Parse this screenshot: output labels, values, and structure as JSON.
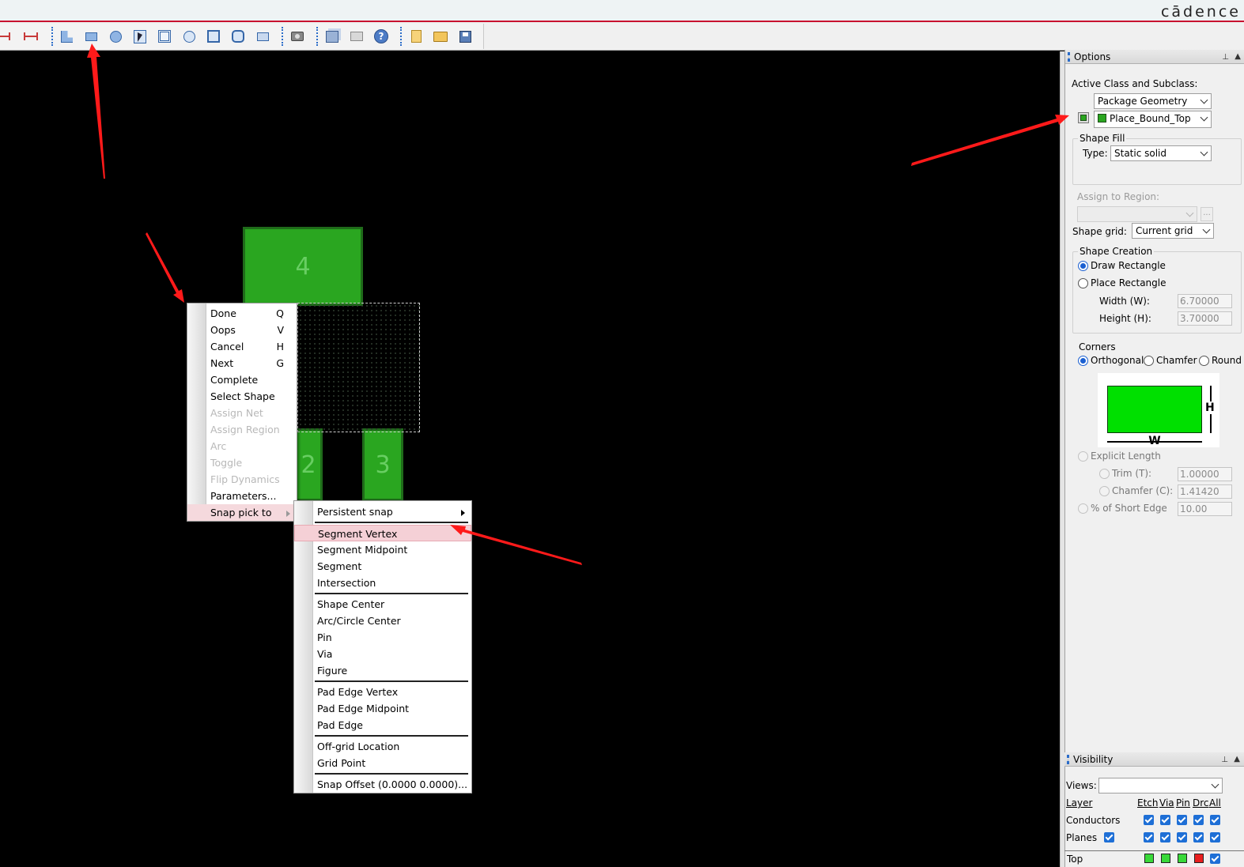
{
  "brand": {
    "name": "cādence"
  },
  "toolbar": {
    "buttons": [
      {
        "icon": "dimension-icon"
      },
      {
        "icon": "dimension-icon"
      },
      {
        "icon": "l-shape-icon"
      },
      {
        "icon": "rectangle-icon"
      },
      {
        "icon": "circle-icon"
      },
      {
        "icon": "select-shape-icon"
      },
      {
        "icon": "shape-edit-icon"
      },
      {
        "icon": "shape-void-icon"
      },
      {
        "icon": "square-icon"
      },
      {
        "icon": "void-circle-icon"
      },
      {
        "icon": "shape-frame-icon"
      },
      {
        "icon": "camera-icon"
      },
      {
        "icon": "stack-icon"
      },
      {
        "icon": "envelope-icon"
      },
      {
        "icon": "help-icon"
      },
      {
        "icon": "new-file-icon"
      },
      {
        "icon": "open-folder-icon"
      },
      {
        "icon": "save-icon"
      }
    ],
    "help_glyph": "?"
  },
  "canvas": {
    "pads": [
      {
        "label": "4"
      },
      {
        "label": "2"
      },
      {
        "label": "3"
      }
    ]
  },
  "context_menu": {
    "items": [
      {
        "label": "Done",
        "key": "Q",
        "enabled": true
      },
      {
        "label": "Oops",
        "key": "V",
        "enabled": true
      },
      {
        "label": "Cancel",
        "key": "H",
        "enabled": true
      },
      {
        "label": "Next",
        "key": "G",
        "enabled": true
      },
      {
        "label": "Complete",
        "key": "",
        "enabled": true
      },
      {
        "label": "Select Shape",
        "key": "",
        "enabled": true
      },
      {
        "label": "Assign Net",
        "key": "",
        "enabled": false
      },
      {
        "label": "Assign Region",
        "key": "",
        "enabled": false
      },
      {
        "label": "Arc",
        "key": "",
        "enabled": false
      },
      {
        "label": "Toggle",
        "key": "",
        "enabled": false
      },
      {
        "label": "Flip Dynamics",
        "key": "",
        "enabled": false
      },
      {
        "label": "Parameters...",
        "key": "",
        "enabled": true
      },
      {
        "label": "Snap pick to",
        "key": "",
        "enabled": true,
        "highlighted": true
      }
    ]
  },
  "snap_menu": {
    "persistent": "Persistent snap",
    "group1": [
      "Segment Vertex",
      "Segment Midpoint",
      "Segment",
      "Intersection"
    ],
    "group2": [
      "Shape Center",
      "Arc/Circle Center",
      "Pin",
      "Via",
      "Figure"
    ],
    "group3": [
      "Pad Edge Vertex",
      "Pad Edge Midpoint",
      "Pad Edge"
    ],
    "group4": [
      "Off-grid Location",
      "Grid Point"
    ],
    "offset": "Snap Offset (0.0000 0.0000)..."
  },
  "options": {
    "title": "Options",
    "active_class_label": "Active Class and Subclass:",
    "class_value": "Package Geometry",
    "subclass_value": "Place_Bound_Top",
    "subclass_color": "#2aa620",
    "shape_fill_label": "Shape Fill",
    "type_label": "Type:",
    "type_value": "Static solid",
    "assign_region_label": "Assign to Region:",
    "assign_region_btn": "...",
    "shape_grid_label": "Shape grid:",
    "shape_grid_value": "Current grid",
    "shape_creation_label": "Shape Creation",
    "draw_rect": "Draw Rectangle",
    "place_rect": "Place Rectangle",
    "width_label": "Width (W):",
    "width_value": "6.70000",
    "height_label": "Height (H):",
    "height_value": "3.70000",
    "corners_label": "Corners",
    "corner_orth": "Orthogonal",
    "corner_chamfer": "Chamfer",
    "corner_round": "Round",
    "diagram_w": "W",
    "diagram_h": "H",
    "explicit_length": "Explicit Length",
    "trim_label": "Trim (T):",
    "trim_value": "1.00000",
    "chamfer_label": "Chamfer (C):",
    "chamfer_value": "1.41420",
    "short_edge_label": "% of Short Edge",
    "short_edge_value": "10.00"
  },
  "visibility": {
    "title": "Visibility",
    "views_label": "Views:",
    "views_value": "",
    "headers": {
      "layer": "Layer",
      "etch": "Etch",
      "via": "Via",
      "pin": "Pin",
      "drc": "Drc",
      "all": "All"
    },
    "rows": [
      {
        "name": "Conductors"
      },
      {
        "name": "Planes"
      },
      {
        "name": "Top"
      }
    ]
  }
}
